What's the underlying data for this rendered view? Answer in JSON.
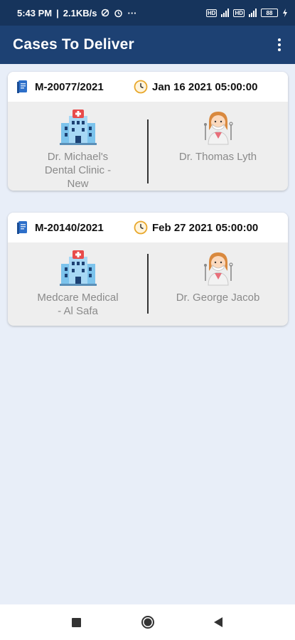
{
  "status_bar": {
    "time": "5:43 PM",
    "speed": "2.1KB/s",
    "more": "···",
    "battery": "88"
  },
  "app_bar": {
    "title": "Cases To Deliver"
  },
  "cases": [
    {
      "case_id": "M-20077/2021",
      "date": "Jan 16 2021 05:00:00",
      "clinic_lines": [
        "Dr. Michael's",
        "Dental Clinic -",
        "New"
      ],
      "doctor": "Dr. Thomas Lyth"
    },
    {
      "case_id": "M-20140/2021",
      "date": "Feb 27 2021 05:00:00",
      "clinic_lines": [
        "Medcare Medical",
        "- Al Safa"
      ],
      "doctor": "Dr. George Jacob"
    }
  ],
  "colors": {
    "status_bar": "#16345c",
    "app_bar": "#1d4173",
    "background": "#e8eef8",
    "card_body": "#eeeeee",
    "label_gray": "#8a8a8a"
  },
  "icons": {
    "case": "case-book-icon",
    "date": "clock-icon",
    "clinic": "hospital-icon",
    "doctor": "dentist-icon",
    "menu": "more-vert-icon",
    "nav": [
      "recents-square-icon",
      "home-circle-icon",
      "back-triangle-icon"
    ]
  }
}
